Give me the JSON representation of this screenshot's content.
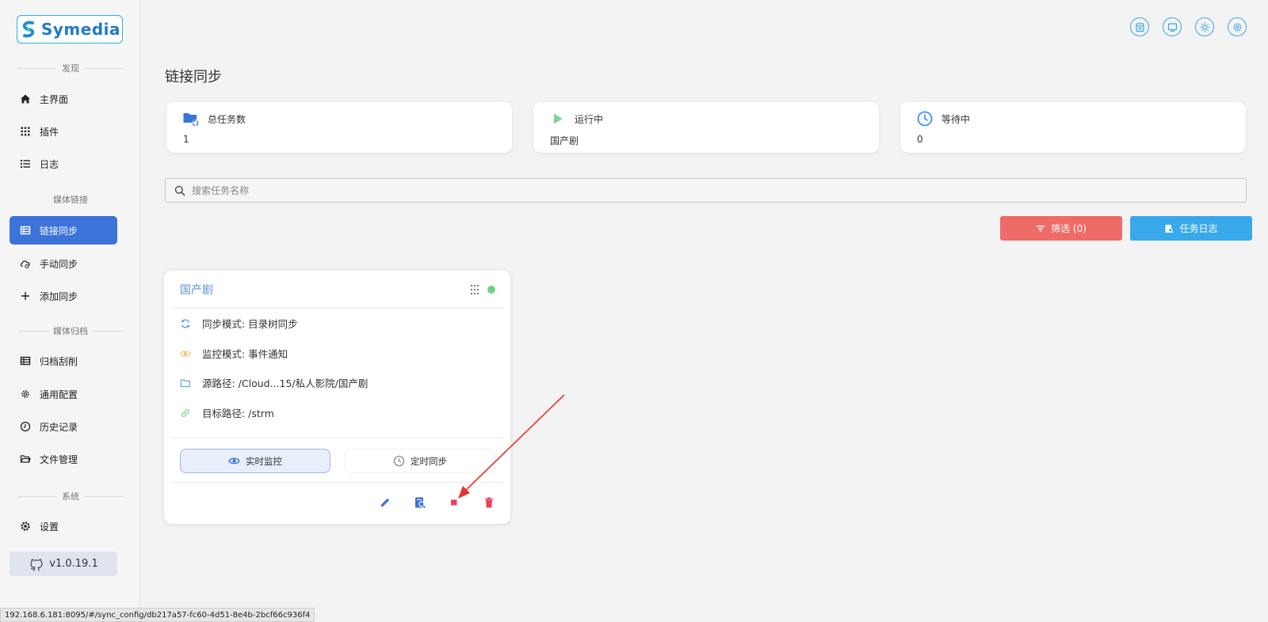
{
  "app": {
    "logo_text": "Symedia",
    "brand_color": "#2479c6",
    "accent": "#3c73d8"
  },
  "sidebar": {
    "sections": {
      "discover": "发现",
      "media_link": "媒体链接",
      "media_archive": "媒体归档",
      "system": "系统"
    },
    "items": [
      {
        "label": "主界面",
        "icon": "home-icon"
      },
      {
        "label": "插件",
        "icon": "grid-icon"
      },
      {
        "label": "日志",
        "icon": "list-icon"
      },
      {
        "label": "链接同步",
        "icon": "table-icon",
        "active": true
      },
      {
        "label": "手动同步",
        "icon": "cloud-sync-icon"
      },
      {
        "label": "添加同步",
        "icon": "plus-icon"
      },
      {
        "label": "归档刮削",
        "icon": "table-icon"
      },
      {
        "label": "通用配置",
        "icon": "gear-outline-icon"
      },
      {
        "label": "历史记录",
        "icon": "clock-icon"
      },
      {
        "label": "文件管理",
        "icon": "folder-open-icon"
      },
      {
        "label": "设置",
        "icon": "gear-icon"
      }
    ],
    "version": "v1.0.19.1"
  },
  "header": {
    "icons": [
      "calendar-icon",
      "monitor-icon",
      "sun-icon",
      "settings-icon"
    ]
  },
  "page": {
    "title": "链接同步",
    "stats": [
      {
        "label": "总任务数",
        "value": "1",
        "icon": "folder-sync-icon"
      },
      {
        "label": "运行中",
        "value": "国产剧",
        "icon": "play-icon"
      },
      {
        "label": "等待中",
        "value": "0",
        "icon": "clock-icon"
      }
    ],
    "search_placeholder": "搜索任务名称",
    "filter_button": "筛选 (0)",
    "log_button": "任务日志"
  },
  "task": {
    "name": "国产剧",
    "status_color": "#6fd28a",
    "rows": [
      {
        "text": "同步模式: 目录树同步",
        "icon": "sync-icon"
      },
      {
        "text": "监控模式: 事件通知",
        "icon": "eye-icon"
      },
      {
        "text": "源路径: /Cloud...15/私人影院/国产剧",
        "icon": "folder-icon"
      },
      {
        "text": "目标路径: /strm",
        "icon": "link-icon"
      }
    ],
    "live_label": "实时监控",
    "schedule_label": "定时同步"
  },
  "status_bar": {
    "url": "192.168.6.181:8095/#/sync_config/db217a57-fc60-4d51-8e4b-2bcf66c936f4"
  }
}
